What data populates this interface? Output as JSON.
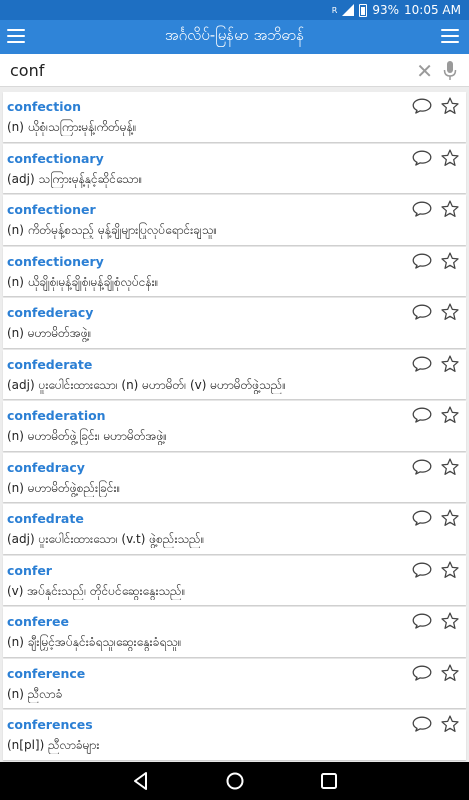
{
  "status": {
    "sim": "R",
    "battery": "93%",
    "time": "10:05 AM"
  },
  "app": {
    "title": "အင်္ဂလိပ်-မြန်မာ အဘိဓာန်"
  },
  "search": {
    "value": "conf"
  },
  "entries": [
    {
      "word": "confection",
      "definition": "(n) ယိုစုံ၊သကြားမုန့်၊ကိတ်မုန့်။"
    },
    {
      "word": "confectionary",
      "definition": "(adj) သကြားမုန့်နှင့်ဆိုင်သော။"
    },
    {
      "word": "confectioner",
      "definition": "(n) ကိတ်မုန့်စသည့် မုန့်ချိုများပြုလုပ်ရောင်းချသူ။"
    },
    {
      "word": "confectionery",
      "definition": "(n) ယိုချိုစုံ၊မုန့်ချိုစုံ၊မုန့်ချိုစုံလုပ်ငန်း။"
    },
    {
      "word": "confederacy",
      "definition": "(n) မဟာမိတ်အဖွဲ့။"
    },
    {
      "word": "confederate",
      "definition": "(adj) ပူးပေါင်းထားသော၊ (n) မဟာမိတ်၊ (v) မဟာမိတ်ဖွဲ့သည်။"
    },
    {
      "word": "confederation",
      "definition": "(n) မဟာမိတ်ဖွဲ့ခြင်း၊ မဟာမိတ်အဖွဲ့။"
    },
    {
      "word": "confedracy",
      "definition": "(n) မဟာမိတ်ဖွဲ့စည်းခြင်း။"
    },
    {
      "word": "confedrate",
      "definition": "(adj) ပူးပေါင်းထားသော၊ (v.t) ဖွဲ့စည်းသည်။"
    },
    {
      "word": "confer",
      "definition": "(v) အပ်နှင်းသည်၊ တိုင်ပင်ဆွေးနွေးသည်။"
    },
    {
      "word": "conferee",
      "definition": "(n) ချီးမြှင့်အပ်နှင်းခံရသူ၊ဆွေးနွေးခံရသူ။"
    },
    {
      "word": "conference",
      "definition": "(n) ညီလာခံ"
    },
    {
      "word": "conferences",
      "definition": "(n[pl]) ညီလာခံများ"
    }
  ],
  "icons": {
    "comment": "comment-icon",
    "star": "star-icon"
  },
  "colors": {
    "status_bar": "#1e6fc2",
    "app_bar": "#2f84d8",
    "word": "#2b7fd4"
  }
}
